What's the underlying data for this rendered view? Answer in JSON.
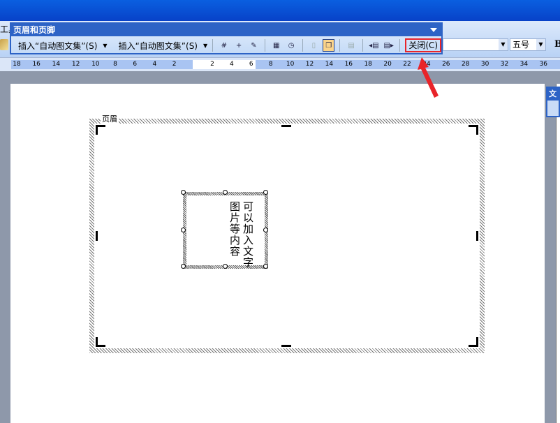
{
  "menu": {
    "tools_partial": "工具"
  },
  "header_footer_toolbar": {
    "title": "页眉和页脚",
    "insert_autotext_1": "插入“自动图文集”(S)",
    "insert_autotext_2": "插入“自动图文集”(S)",
    "close_label": "关闭(C)",
    "icons": [
      "insert-page-number-icon",
      "insert-page-count-icon",
      "format-page-number-icon",
      "insert-date-icon",
      "insert-time-icon",
      "page-setup-icon",
      "show-hide-document-text-icon",
      "same-as-previous-icon",
      "show-previous-icon",
      "show-next-icon"
    ]
  },
  "formatting": {
    "font_size": "五号",
    "bold_label": "B"
  },
  "ruler": {
    "left_ticks": [
      "18",
      "16",
      "14",
      "12",
      "10",
      "8",
      "6",
      "4",
      "2"
    ],
    "right_ticks": [
      "2",
      "4",
      "6",
      "8",
      "10",
      "12",
      "14",
      "16",
      "18",
      "20",
      "22",
      "24",
      "26",
      "28",
      "30",
      "32",
      "34",
      "36"
    ]
  },
  "document": {
    "header_label": "页眉",
    "textbox_col1": "可以加入文字",
    "textbox_col2": "图片等内容",
    "paragraph_mark": "↵"
  },
  "floating_toolbar": {
    "title_partial": "文"
  },
  "annotation": {
    "color": "#e8242a"
  }
}
